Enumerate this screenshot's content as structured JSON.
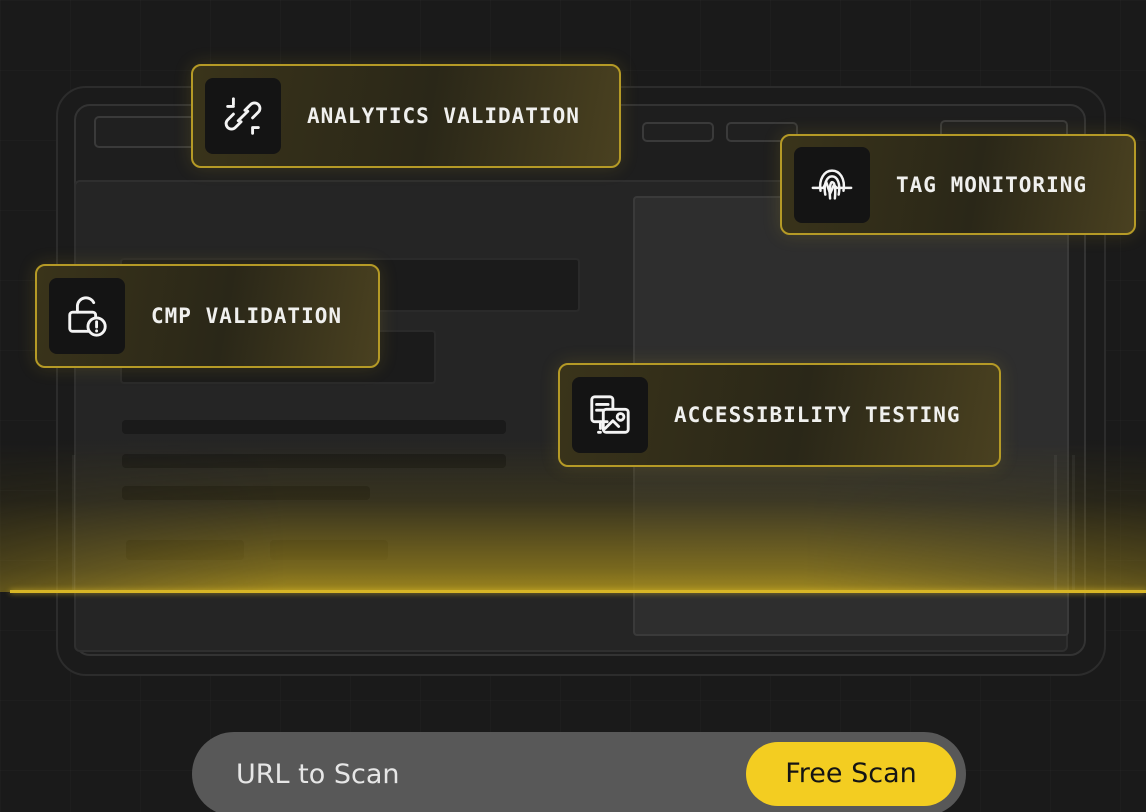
{
  "features": {
    "analytics_validation": {
      "label": "ANALYTICS VALIDATION",
      "icon": "broken-link-icon"
    },
    "tag_monitoring": {
      "label": "TAG MONITORING",
      "icon": "fingerprint-pulse-icon"
    },
    "cmp_validation": {
      "label": "CMP VALIDATION",
      "icon": "unlocked-padlock-alert-icon"
    },
    "accessibility_testing": {
      "label": "ACCESSIBILITY TESTING",
      "icon": "document-image-icon"
    }
  },
  "scan_form": {
    "url_placeholder": "URL to Scan",
    "url_value": "",
    "submit_label": "Free Scan"
  },
  "colors": {
    "accent": "#f3cd21",
    "badge_border": "#b59a26",
    "background": "#1a1a1a"
  }
}
